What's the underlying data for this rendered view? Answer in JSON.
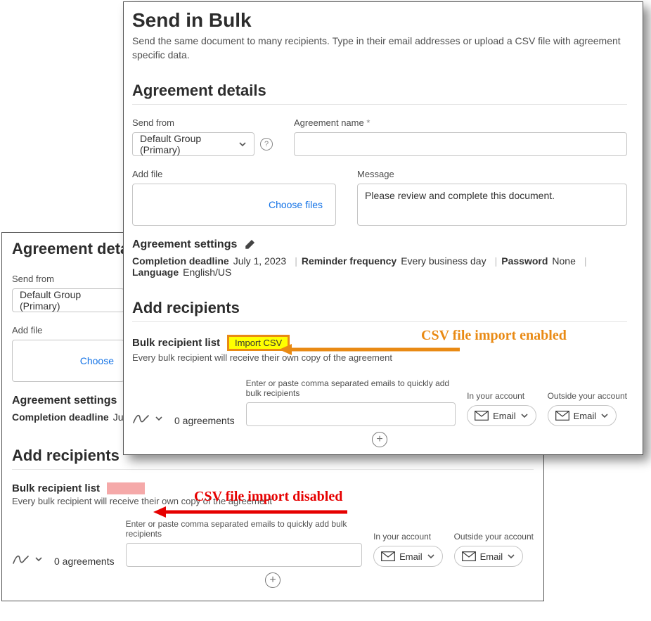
{
  "header": {
    "title": "Send in Bulk",
    "subtitle": "Send the same document to many recipients. Type in their email addresses or upload a CSV file with agreement specific data."
  },
  "agreement_details": {
    "heading": "Agreement details",
    "send_from_label": "Send from",
    "send_from_value": "Default Group (Primary)",
    "agreement_name_label": "Agreement name",
    "add_file_label": "Add file",
    "choose_files": "Choose files",
    "message_label": "Message",
    "message_value": "Please review and complete this document."
  },
  "agreement_settings": {
    "title": "Agreement settings",
    "completion_deadline_label": "Completion deadline",
    "completion_deadline_value": "July 1, 2023",
    "reminder_label": "Reminder frequency",
    "reminder_value": "Every business day",
    "password_label": "Password",
    "password_value": "None",
    "language_label": "Language",
    "language_value": "English/US"
  },
  "add_recipients": {
    "heading": "Add recipients",
    "bulk_list_label": "Bulk recipient list",
    "import_csv": "Import CSV",
    "bulk_sub": "Every bulk recipient will receive their own copy of the agreement",
    "agreements_count": "0 agreements",
    "email_input_hint": "Enter or paste comma separated emails to quickly add bulk recipients",
    "in_your_account": "In your account",
    "outside_your_account": "Outside your account",
    "email_btn": "Email"
  },
  "annotations": {
    "enabled": "CSV file import enabled",
    "disabled": "CSV file import disabled"
  },
  "back": {
    "completion_deadline_partial": "July"
  }
}
